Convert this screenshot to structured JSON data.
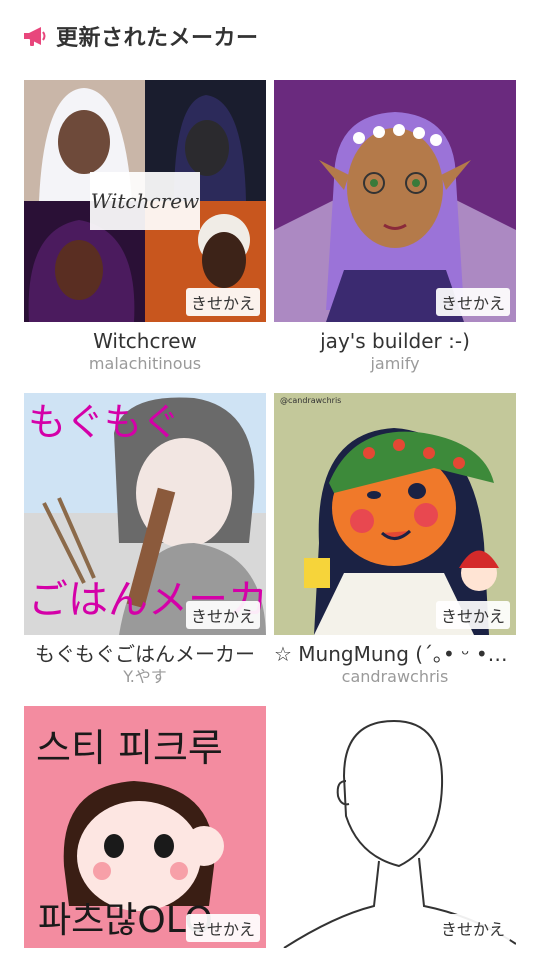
{
  "header": {
    "title": "更新されたメーカー",
    "icon": "megaphone-icon",
    "icon_color": "#e8467c"
  },
  "badge_label": "きせかえ",
  "makers": [
    {
      "name": "Witchcrew",
      "author": "malachitinous",
      "thumb_label": "Witchcrew",
      "thumb": "witch-collage"
    },
    {
      "name": "jay's builder :-)",
      "author": "jamify",
      "thumb": "elf-fairy"
    },
    {
      "name": "もぐもぐごはんメーカー",
      "author": "Y.やす",
      "thumb_label_top": "もぐもぐ",
      "thumb_label_bottom": "ごはんメーカ",
      "thumb": "anime-boy"
    },
    {
      "name": "☆ MungMung (´｡• ᵕ •｡…",
      "author": "candrawchris",
      "thumb_label": "@candrawchris",
      "thumb": "bandana-girl"
    },
    {
      "name": "",
      "author": "",
      "thumb_label_top": "스티 피크루",
      "thumb_label_bottom": "파츠많OLO",
      "thumb": "pink-portrait"
    },
    {
      "name": "",
      "author": "",
      "thumb": "outline-base"
    }
  ]
}
